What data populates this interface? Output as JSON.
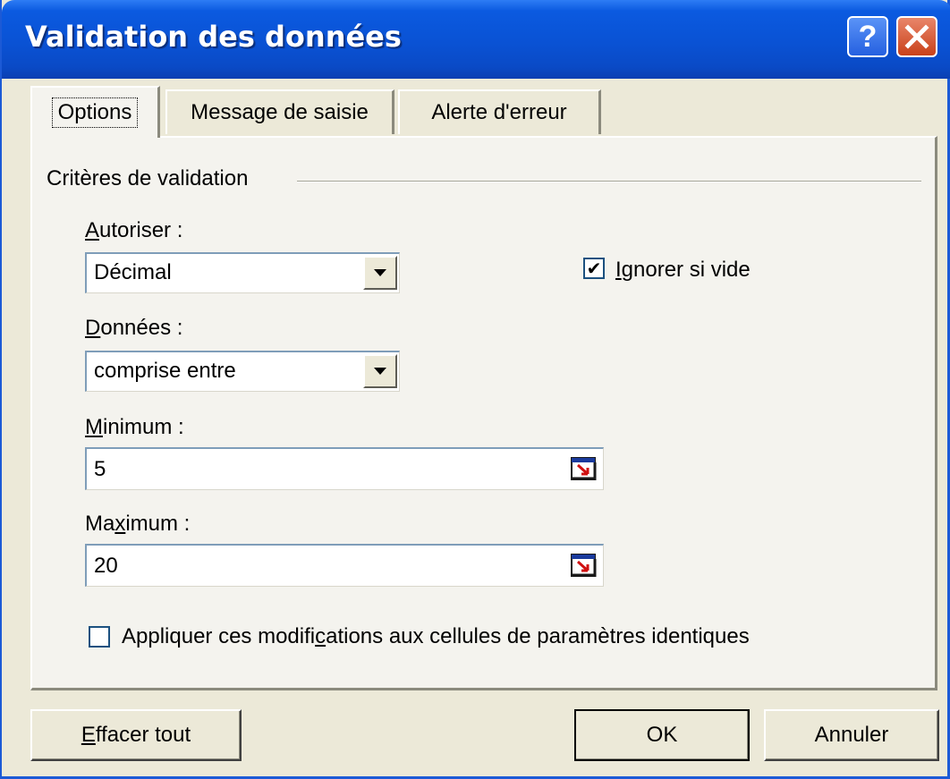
{
  "window": {
    "title": "Validation des données",
    "help_symbol": "?",
    "close_symbol": "✕"
  },
  "tabs": [
    {
      "label": "Options",
      "active": true
    },
    {
      "label": "Message de saisie",
      "active": false
    },
    {
      "label": "Alerte d'erreur",
      "active": false
    }
  ],
  "criteria": {
    "group_title": "Critères de validation",
    "allow": {
      "label_first": "A",
      "label_rest": "utoriser :",
      "value": "Décimal"
    },
    "ignore_blank": {
      "checked": true,
      "label_first": "I",
      "label_rest": "gnorer si vide",
      "check_mark": "✔"
    },
    "data": {
      "label_first": "D",
      "label_rest": "onnées :",
      "value": "comprise entre"
    },
    "minimum": {
      "label_first": "M",
      "label_rest": "inimum :",
      "value": "5"
    },
    "maximum": {
      "label_pre": "Ma",
      "label_u": "x",
      "label_rest": "imum :",
      "value": "20"
    },
    "apply_all": {
      "checked": false,
      "label_pre": "Appliquer ces modifi",
      "label_u": "c",
      "label_rest": "ations aux cellules de paramètres identiques"
    }
  },
  "buttons": {
    "clear_first": "E",
    "clear_rest": "ffacer tout",
    "ok": "OK",
    "cancel": "Annuler"
  },
  "colors": {
    "titlebar": "#0a52d4",
    "dialog_bg": "#ece9d8",
    "panel_bg": "#f4f3ee"
  }
}
